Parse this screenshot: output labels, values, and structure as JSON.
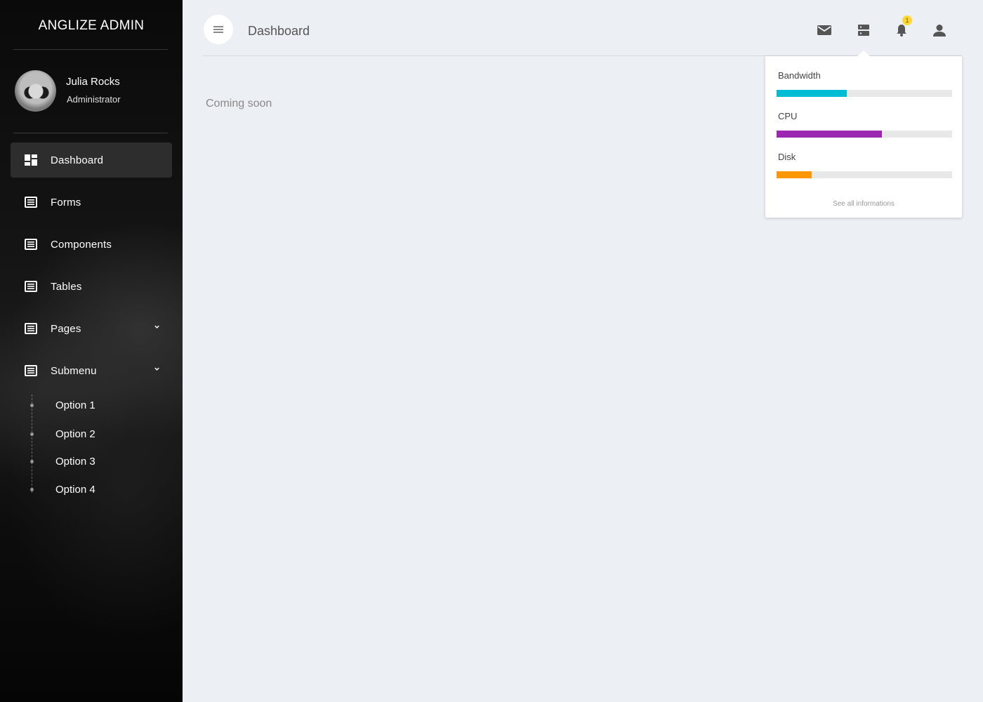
{
  "sidebar": {
    "brand": "ANGLIZE ADMIN",
    "user": {
      "name": "Julia Rocks",
      "role": "Administrator"
    },
    "items": [
      {
        "label": "Dashboard",
        "icon": "dashboard-icon",
        "active": true
      },
      {
        "label": "Forms",
        "icon": "list-icon"
      },
      {
        "label": "Components",
        "icon": "list-icon"
      },
      {
        "label": "Tables",
        "icon": "list-icon"
      },
      {
        "label": "Pages",
        "icon": "list-icon",
        "expandable": true
      },
      {
        "label": "Submenu",
        "icon": "list-icon",
        "expandable": true
      }
    ],
    "submenu": [
      {
        "label": "Option 1"
      },
      {
        "label": "Option 2"
      },
      {
        "label": "Option 3"
      },
      {
        "label": "Option 4"
      }
    ]
  },
  "header": {
    "title": "Dashboard",
    "icons": [
      "menu-icon",
      "mail-icon",
      "server-icon",
      "bell-icon",
      "person-icon"
    ],
    "notification_count": "1"
  },
  "main": {
    "content_text": "Coming soon"
  },
  "popover": {
    "stats": [
      {
        "label": "Bandwidth",
        "value": 0.4,
        "color": "#00bcd4"
      },
      {
        "label": "CPU",
        "value": 0.6,
        "color": "#9c27b0"
      },
      {
        "label": "Disk",
        "value": 0.2,
        "color": "#ff9800"
      }
    ],
    "link": "See all informations"
  },
  "colors": {
    "background": "#eceff4",
    "sidebar": "#0d0d0d",
    "badge": "#fdd835"
  }
}
